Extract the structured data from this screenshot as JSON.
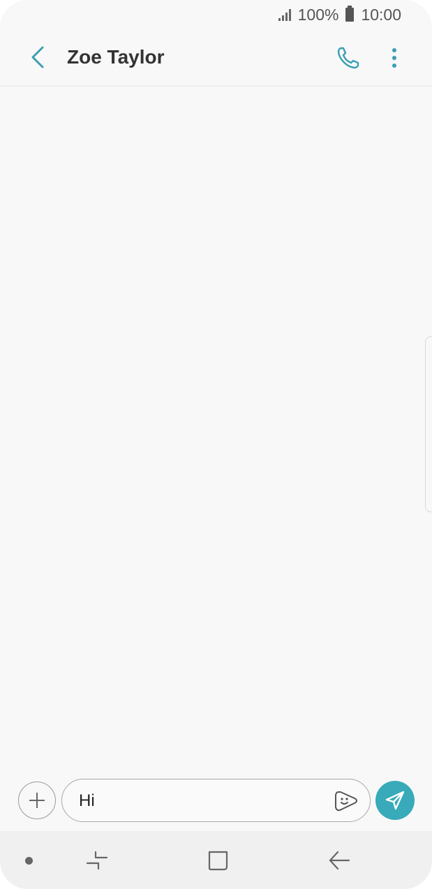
{
  "status_bar": {
    "battery_percent": "100%",
    "time": "10:00",
    "icons": [
      "signal-icon",
      "battery-icon"
    ]
  },
  "header": {
    "contact_name": "Zoe Taylor",
    "icons": [
      "back-arrow-icon",
      "phone-icon",
      "more-vertical-icon"
    ]
  },
  "composer": {
    "message_value": "Hi",
    "icons": [
      "plus-icon",
      "sticker-icon",
      "send-icon"
    ]
  },
  "nav_bar": {
    "icons": [
      "dot-icon",
      "recents-icon",
      "home-icon",
      "back-icon"
    ]
  },
  "colors": {
    "accent": "#38aab9",
    "background": "#f8f8f8",
    "nav_background": "#f0f0f0"
  }
}
